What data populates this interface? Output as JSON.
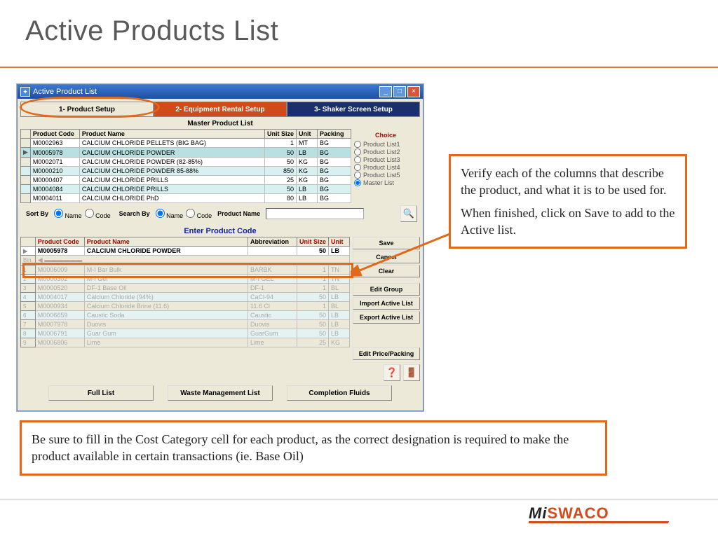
{
  "title": "Active Products List",
  "window": {
    "title": "Active Product List",
    "tabs": {
      "t1": "1- Product Setup",
      "t2": "2- Equipment Rental Setup",
      "t3": "3- Shaker Screen Setup"
    },
    "master_label": "Master Product List",
    "cols": {
      "code": "Product Code",
      "name": "Product Name",
      "usize": "Unit Size",
      "unit": "Unit",
      "packing": "Packing"
    },
    "rows": [
      {
        "code": "M0002963",
        "name": "CALCIUM CHLORIDE PELLETS (BIG BAG)",
        "usize": "1",
        "unit": "MT",
        "packing": "BG"
      },
      {
        "code": "M0005978",
        "name": "CALCIUM CHLORIDE POWDER",
        "usize": "50",
        "unit": "LB",
        "packing": "BG"
      },
      {
        "code": "M0002071",
        "name": "CALCIUM CHLORIDE POWDER (82-85%)",
        "usize": "50",
        "unit": "KG",
        "packing": "BG"
      },
      {
        "code": "M0000210",
        "name": "CALCIUM CHLORIDE POWDER 85-88%",
        "usize": "850",
        "unit": "KG",
        "packing": "BG"
      },
      {
        "code": "M0000407",
        "name": "CALCIUM CHLORIDE PRILLS",
        "usize": "25",
        "unit": "KG",
        "packing": "BG"
      },
      {
        "code": "M0004084",
        "name": "CALCIUM CHLORIDE PRILLS",
        "usize": "50",
        "unit": "LB",
        "packing": "BG"
      },
      {
        "code": "M0004011",
        "name": "CALCIUM CHLORIDE PhD",
        "usize": "80",
        "unit": "LB",
        "packing": "BG"
      }
    ],
    "choice": {
      "title": "Choice",
      "items": [
        "Product List1",
        "Product List2",
        "Product List3",
        "Product List4",
        "Product List5",
        "Master List"
      ],
      "selected": 5
    },
    "sortby_label": "Sort By",
    "searchby_label": "Search By",
    "opt_name": "Name",
    "opt_code": "Code",
    "productname_label": "Product Name",
    "enter_label": "Enter Product Code",
    "entry_cols": {
      "code": "Product Code",
      "name": "Product Name",
      "abbr": "Abbreviation",
      "usize": "Unit Size",
      "unit": "Unit"
    },
    "entry_bold": {
      "code": "M0005978",
      "name": "CALCIUM CHLORIDE POWDER",
      "abbr": "",
      "usize": "50",
      "unit": "LB"
    },
    "entry_rows": [
      {
        "n": "1",
        "code": "M0006009",
        "name": "M-I Bar Bulk",
        "abbr": "BARBK",
        "usize": "1",
        "unit": "TN"
      },
      {
        "n": "2",
        "code": "M0000302",
        "name": "M-I Gel",
        "abbr": "M-I GEL",
        "usize": "1",
        "unit": "TN"
      },
      {
        "n": "3",
        "code": "M0000520",
        "name": "DF-1 Base Oil",
        "abbr": "DF-1",
        "usize": "1",
        "unit": "BL"
      },
      {
        "n": "4",
        "code": "M0004017",
        "name": "Calcium Chloride (94%)",
        "abbr": "CaCl-94",
        "usize": "50",
        "unit": "LB"
      },
      {
        "n": "5",
        "code": "M0000934",
        "name": "Calcium Chloride Brine (11.6)",
        "abbr": "11.6 Cl",
        "usize": "1",
        "unit": "BL"
      },
      {
        "n": "6",
        "code": "M0006659",
        "name": "Caustic Soda",
        "abbr": "Caustic",
        "usize": "50",
        "unit": "LB"
      },
      {
        "n": "7",
        "code": "M0007978",
        "name": "Duovis",
        "abbr": "Duovis",
        "usize": "50",
        "unit": "LB"
      },
      {
        "n": "8",
        "code": "M0006791",
        "name": "Guar Gum",
        "abbr": "GuarGum",
        "usize": "50",
        "unit": "LB"
      },
      {
        "n": "9",
        "code": "M0006806",
        "name": "Lime",
        "abbr": "Lime",
        "usize": "25",
        "unit": "KG"
      }
    ],
    "buttons": {
      "save": "Save",
      "cancel": "Cancel",
      "clear": "Clear",
      "edit_group": "Edit Group",
      "import": "Import Active List",
      "export": "Export Active List",
      "edit_price": "Edit Price/Packing",
      "full": "Full List",
      "waste": "Waste Management List",
      "completion": "Completion Fluids"
    },
    "bin_label": "Bin."
  },
  "callouts": {
    "right1": "Verify each of the columns that describe the product, and what it is to be used for.",
    "right2": "When finished, click on Save to add to the Active list.",
    "bottom": "Be sure to fill in the Cost Category cell for each product, as the correct designation is required to make the product available in certain transactions (ie. Base Oil)"
  },
  "logo": {
    "mi": "Mi",
    "swaco": "SWACO"
  },
  "icons": {
    "search": "🔍",
    "help": "❓",
    "exit": "🚪"
  }
}
